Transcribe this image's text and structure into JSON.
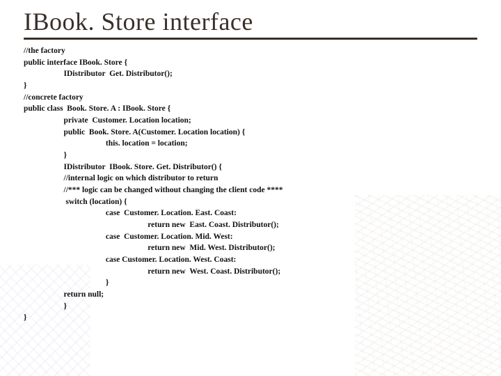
{
  "slide": {
    "title": "IBook. Store interface",
    "code_lines": [
      "//the factory",
      "public interface IBook. Store {",
      "                    IDistributor  Get. Distributor();",
      "}",
      "//concrete factory",
      "public class  Book. Store. A : IBook. Store {",
      "                    private  Customer. Location location;",
      "                    public  Book. Store. A(Customer. Location location) {",
      "                                         this. location = location;",
      "                    }",
      "                    IDistributor  IBook. Store. Get. Distributor() {",
      "                    //internal logic on which distributor to return",
      "                    //*** logic can be changed without changing the client code ****",
      "                     switch (location) {",
      "                                         case  Customer. Location. East. Coast:",
      "                                                              return new  East. Coast. Distributor();",
      "                                         case  Customer. Location. Mid. West:",
      "                                                              return new  Mid. West. Distributor();",
      "                                         case Customer. Location. West. Coast:",
      "                                                              return new  West. Coast. Distributor();",
      "                                         }",
      "                    return null;",
      "                    }",
      "}"
    ]
  }
}
